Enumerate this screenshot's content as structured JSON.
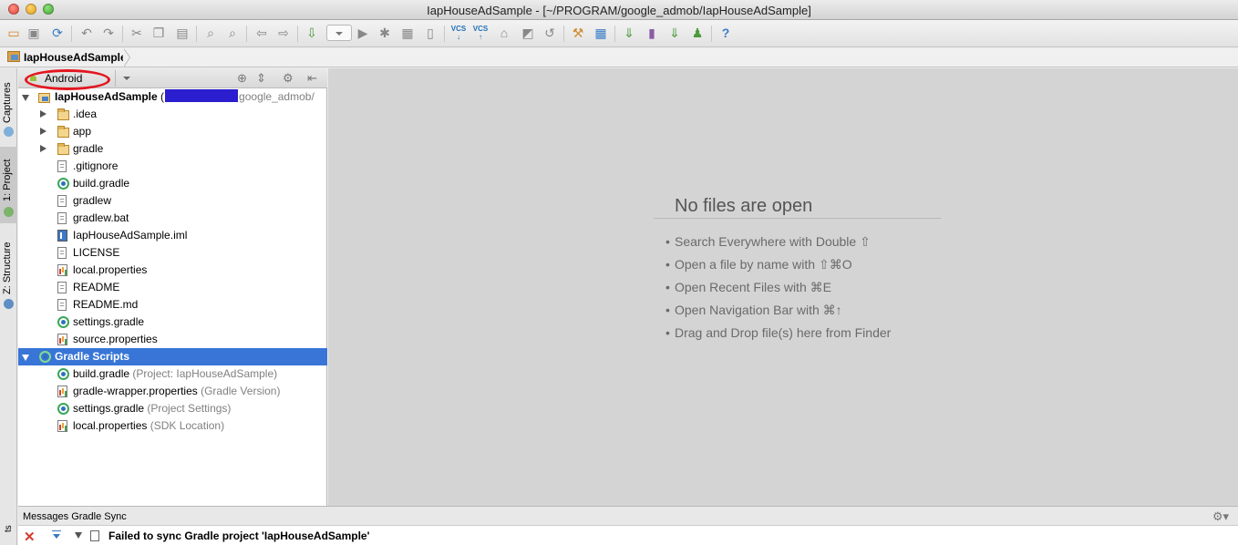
{
  "window": {
    "title": "IapHouseAdSample - [~/PROGRAM/google_admob/IapHouseAdSample]"
  },
  "toolbar": {
    "icons": [
      "open-icon",
      "save-icon",
      "sync-icon",
      "undo-icon",
      "redo-icon",
      "cut-icon",
      "copy-icon",
      "paste-icon",
      "find-icon",
      "replace-icon",
      "back-icon",
      "forward-icon",
      "make-icon",
      "run-config-dropdown",
      "run-icon",
      "debug-icon",
      "coverage-icon",
      "attach-icon",
      "vcs-update-icon",
      "vcs-commit-icon",
      "vcs-compare-icon",
      "history-icon",
      "revert-icon",
      "settings-icon",
      "project-structure-icon",
      "sync-gradle-icon",
      "avd-manager-icon",
      "sdk-manager-icon",
      "android-monitor-icon",
      "help-icon"
    ],
    "vcs_label": "VCS"
  },
  "navbar": {
    "breadcrumb": "IapHouseAdSample"
  },
  "left_strip": {
    "tabs": [
      {
        "label": "Captures"
      },
      {
        "label": "1: Project"
      },
      {
        "label": "Z: Structure"
      }
    ]
  },
  "project_panel": {
    "view_selector": "Android",
    "tree": [
      {
        "label": "IapHouseAdSample",
        "prefix": " (",
        "suffix": "google_admob/",
        "icon": "module",
        "expanded": true
      },
      {
        "label": ".idea",
        "icon": "folder"
      },
      {
        "label": "app",
        "icon": "folder"
      },
      {
        "label": "gradle",
        "icon": "folder"
      },
      {
        "label": ".gitignore",
        "icon": "file"
      },
      {
        "label": "build.gradle",
        "icon": "gradle"
      },
      {
        "label": "gradlew",
        "icon": "file"
      },
      {
        "label": "gradlew.bat",
        "icon": "file"
      },
      {
        "label": "IapHouseAdSample.iml",
        "icon": "iml"
      },
      {
        "label": "LICENSE",
        "icon": "file"
      },
      {
        "label": "local.properties",
        "icon": "properties"
      },
      {
        "label": "README",
        "icon": "file"
      },
      {
        "label": "README.md",
        "icon": "file"
      },
      {
        "label": "settings.gradle",
        "icon": "gradle"
      },
      {
        "label": "source.properties",
        "icon": "properties"
      },
      {
        "label": "Gradle Scripts",
        "icon": "gradle",
        "expanded": true,
        "selected": true
      },
      {
        "label": "build.gradle",
        "hint": " (Project: IapHouseAdSample)",
        "icon": "gradle"
      },
      {
        "label": "gradle-wrapper.properties",
        "hint": " (Gradle Version)",
        "icon": "properties"
      },
      {
        "label": "settings.gradle",
        "hint": " (Project Settings)",
        "icon": "gradle"
      },
      {
        "label": "local.properties",
        "hint": " (SDK Location)",
        "icon": "properties"
      }
    ]
  },
  "editor": {
    "empty_title": "No files are open",
    "hints": [
      "Search Everywhere with Double ⇧",
      "Open a file by name with ⇧⌘O",
      "Open Recent Files with ⌘E",
      "Open Navigation Bar with ⌘↑",
      "Drag and Drop file(s) here from Finder"
    ]
  },
  "messages": {
    "title": "Messages Gradle Sync",
    "error": "Failed to sync Gradle project 'IapHouseAdSample'"
  },
  "colors": {
    "selection": "#3875d7",
    "highlight_ellipse": "#e3161f",
    "redaction": "#2a1ecf"
  }
}
